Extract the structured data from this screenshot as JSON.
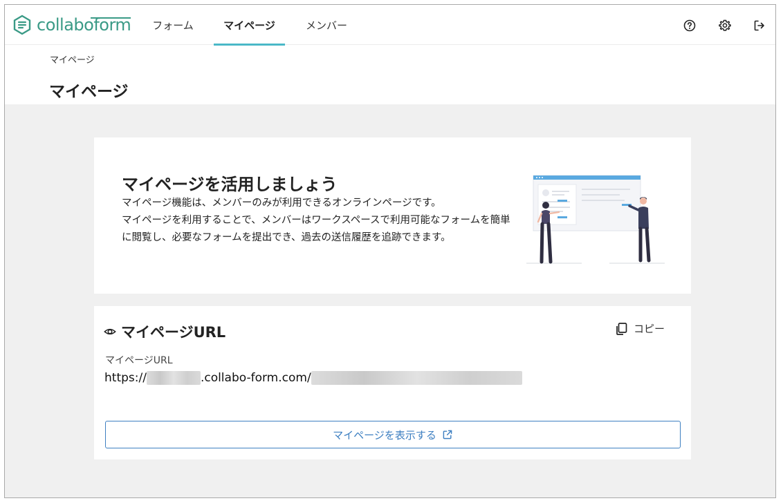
{
  "brand": {
    "name": "collaboform",
    "color": "#3a9a86"
  },
  "nav": {
    "tabs": [
      {
        "label": "フォーム",
        "active": false
      },
      {
        "label": "マイページ",
        "active": true
      },
      {
        "label": "メンバー",
        "active": false
      }
    ],
    "icons": [
      "help-icon",
      "gear-icon",
      "logout-icon"
    ],
    "accent": "#4ab8c7"
  },
  "breadcrumb": "マイページ",
  "page_title": "マイページ",
  "intro": {
    "title": "マイページを活用しましょう",
    "lines": [
      "マイページ機能は、メンバーのみが利用できるオンラインページです。",
      "マイページを利用することで、メンバーはワークスペースで利用可能なフォームを簡単に閲覧し、必要なフォームを提出でき、過去の送信履歴を追跡できます。"
    ]
  },
  "url_section": {
    "heading": "マイページURL",
    "copy_label": "コピー",
    "field_label": "マイページURL",
    "url_prefix": "https://",
    "url_domain": ".collabo-form.com/",
    "view_button": "マイページを表示する",
    "button_color": "#3d7fc1"
  }
}
